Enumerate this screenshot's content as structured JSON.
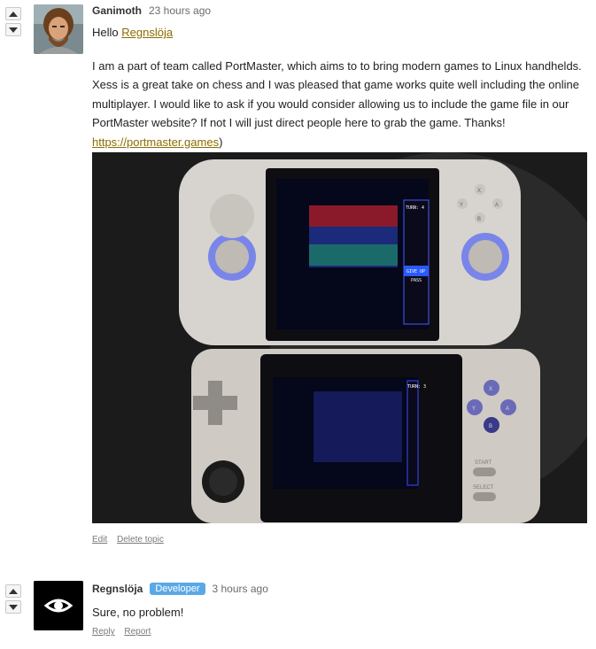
{
  "comments": [
    {
      "author": "Ganimoth",
      "time": "23 hours ago",
      "greeting": "Hello",
      "mention": "Regnslöja",
      "body_main": "I am a part of team called PortMaster, which aims to to bring modern games to Linux handhelds. Xess is a great take on chess and I was  pleased that game works quite well including the online multiplayer. I would like to ask if you would consider allowing us to include the game file in our PortMaster website? If not I will just direct people here to grab the game. Thanks!",
      "link_text": "https://portmaster.games",
      "link_suffix": ")",
      "actions": [
        "Edit",
        "Delete topic"
      ],
      "photo": {
        "top_device": {
          "hud": [
            "TURN: 4",
            "GIVE UP",
            "PASS"
          ],
          "buttons": [
            "X",
            "Y",
            "A",
            "B"
          ]
        },
        "bottom_device": {
          "hud": [
            "TURN: 3"
          ],
          "buttons": [
            "X",
            "Y",
            "A",
            "B",
            "START",
            "SELECT"
          ]
        }
      }
    },
    {
      "author": "Regnslöja",
      "badge": "Developer",
      "time": "3 hours ago",
      "body": "Sure, no problem!",
      "actions": [
        "Reply",
        "Report"
      ]
    }
  ],
  "colors": {
    "link": "#8a6d00",
    "badge": "#5aa9e6"
  },
  "icons": [
    "arrow-up-icon",
    "arrow-down-icon",
    "eye-icon"
  ]
}
